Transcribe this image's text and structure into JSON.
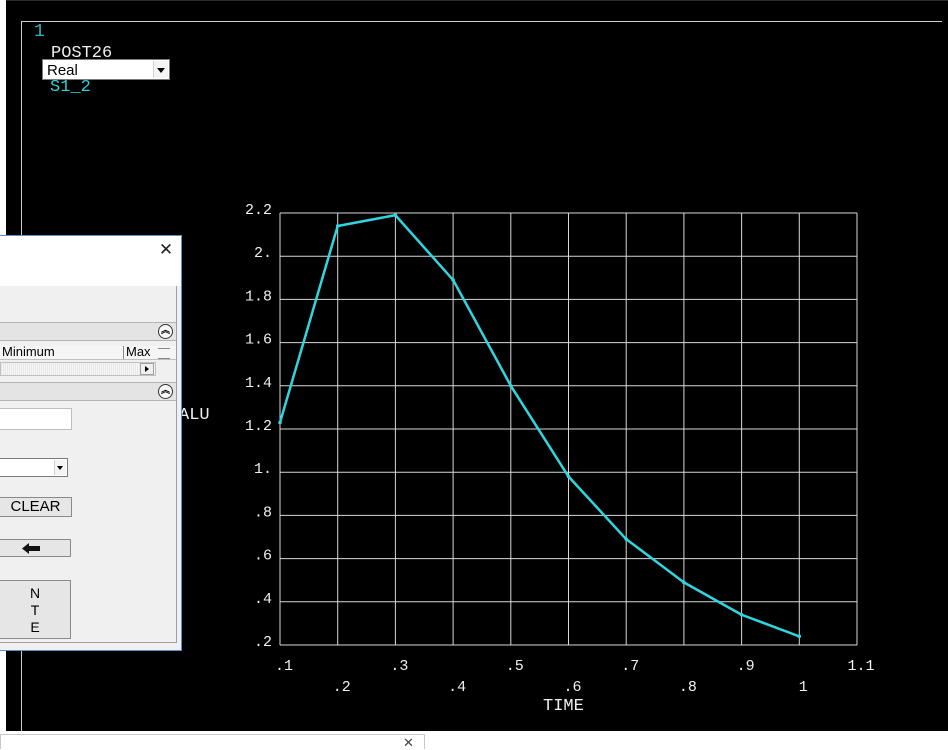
{
  "graphics": {
    "window_number": "1",
    "title": "POST26",
    "legend": "S1_2",
    "ylabel_fragment": "ALU",
    "xlabel": "TIME"
  },
  "chart_data": {
    "type": "line",
    "xlabel": "TIME",
    "ylabel": "",
    "xlim": [
      0.1,
      1.1
    ],
    "ylim": [
      0.2,
      2.2
    ],
    "grid": true,
    "x_ticks": [
      ".1",
      ".2",
      ".3",
      ".4",
      ".5",
      ".6",
      ".7",
      ".8",
      ".9",
      "1",
      "1.1"
    ],
    "y_ticks": [
      ".2",
      ".4",
      ".6",
      ".8",
      "1.",
      "1.2",
      "1.4",
      "1.6",
      "1.8",
      "2.",
      "2.2"
    ],
    "series": [
      {
        "name": "S1_2",
        "color": "#2fd6e0",
        "x": [
          0.1,
          0.2,
          0.3,
          0.4,
          0.5,
          0.6,
          0.7,
          0.8,
          0.9,
          1.0
        ],
        "y": [
          1.23,
          2.14,
          2.19,
          1.89,
          1.4,
          0.98,
          0.69,
          0.49,
          0.34,
          0.24
        ]
      }
    ]
  },
  "dialog": {
    "type_value": "Real",
    "col_minimum": "Minimum",
    "col_max": "Max",
    "clear_label": "CLEAR",
    "nte_lines": [
      "N",
      "T",
      "E"
    ],
    "close_glyph": "✕",
    "collapse_glyph": "︽"
  },
  "bottom_panel": {
    "close_glyph": "✕"
  },
  "colors": {
    "background": "#000000",
    "grid": "#d8d8d8",
    "curve": "#2fd6e0",
    "accent_text": "#2fb6c4"
  }
}
